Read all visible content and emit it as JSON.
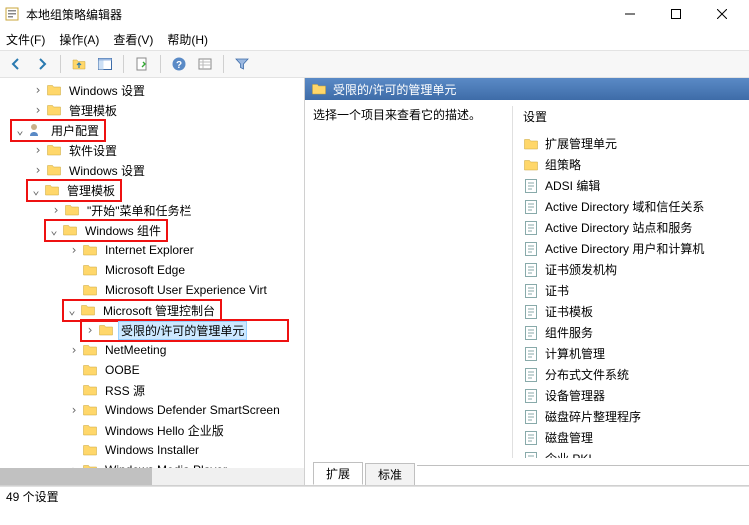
{
  "window": {
    "title": "本地组策略编辑器"
  },
  "menu": {
    "file": "文件(F)",
    "action": "操作(A)",
    "view": "查看(V)",
    "help": "帮助(H)"
  },
  "tree": {
    "windows_settings": "Windows 设置",
    "admin_templates": "管理模板",
    "user_config": "用户配置",
    "software_settings": "软件设置",
    "windows_settings2": "Windows 设置",
    "admin_templates2": "管理模板",
    "start_taskbar": "\"开始\"菜单和任务栏",
    "windows_components": "Windows 组件",
    "ie": "Internet Explorer",
    "edge": "Microsoft Edge",
    "ux_virt": "Microsoft User Experience Virt",
    "mmc": "Microsoft 管理控制台",
    "restricted_units": "受限的/许可的管理单元",
    "netmeeting": "NetMeeting",
    "oobe": "OOBE",
    "rss": "RSS 源",
    "defender_smartscreen": "Windows Defender SmartScreen",
    "hello_enterprise": "Windows Hello 企业版",
    "installer": "Windows Installer",
    "media_player": "Windows Media Player"
  },
  "right": {
    "header": "受限的/许可的管理单元",
    "prompt": "选择一个项目来查看它的描述。",
    "col_setting": "设置",
    "items": [
      {
        "type": "folder",
        "label": "扩展管理单元"
      },
      {
        "type": "folder",
        "label": "组策略"
      },
      {
        "type": "item",
        "label": "ADSI 编辑"
      },
      {
        "type": "item",
        "label": "Active Directory 域和信任关系"
      },
      {
        "type": "item",
        "label": "Active Directory 站点和服务"
      },
      {
        "type": "item",
        "label": "Active Directory 用户和计算机"
      },
      {
        "type": "item",
        "label": "证书颁发机构"
      },
      {
        "type": "item",
        "label": "证书"
      },
      {
        "type": "item",
        "label": "证书模板"
      },
      {
        "type": "item",
        "label": "组件服务"
      },
      {
        "type": "item",
        "label": "计算机管理"
      },
      {
        "type": "item",
        "label": "分布式文件系统"
      },
      {
        "type": "item",
        "label": "设备管理器"
      },
      {
        "type": "item",
        "label": "磁盘碎片整理程序"
      },
      {
        "type": "item",
        "label": "磁盘管理"
      },
      {
        "type": "item",
        "label": "企业 PKI"
      }
    ]
  },
  "tabs": {
    "extended": "扩展",
    "standard": "标准"
  },
  "statusbar": {
    "text": "49 个设置"
  }
}
